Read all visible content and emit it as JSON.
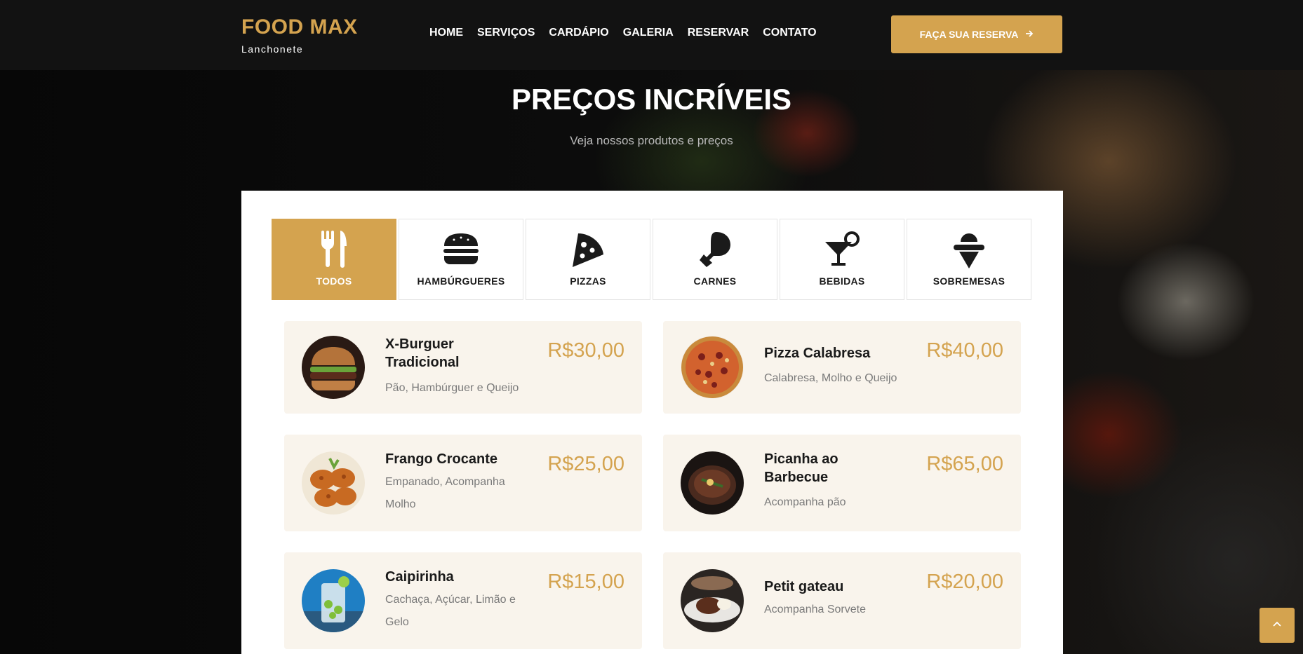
{
  "header": {
    "brand": "FOOD MAX",
    "tagline": "Lanchonete",
    "nav": [
      "HOME",
      "SERVIÇOS",
      "CARDÁPIO",
      "GALERIA",
      "RESERVAR",
      "CONTATO"
    ],
    "cta_label": "FAÇA SUA RESERVA",
    "cta_icon": "arrow-right-icon"
  },
  "hero": {
    "title": "PREÇOS INCRÍVEIS",
    "subtitle": "Veja nossos produtos e preços"
  },
  "tabs": [
    {
      "label": "TODOS",
      "icon": "utensils-icon",
      "active": true
    },
    {
      "label": "HAMBÚRGUERES",
      "icon": "hamburger-icon",
      "active": false
    },
    {
      "label": "PIZZAS",
      "icon": "pizza-slice-icon",
      "active": false
    },
    {
      "label": "CARNES",
      "icon": "drumstick-icon",
      "active": false
    },
    {
      "label": "BEBIDAS",
      "icon": "cocktail-icon",
      "active": false
    },
    {
      "label": "SOBREMESAS",
      "icon": "ice-cream-icon",
      "active": false
    }
  ],
  "menu": [
    {
      "name": "X-Burguer Tradicional",
      "desc": "Pão, Hambúrguer e Queijo",
      "price": "R$30,00",
      "image": "burger-photo"
    },
    {
      "name": "Pizza Calabresa",
      "desc": "Calabresa, Molho e Queijo",
      "price": "R$40,00",
      "image": "pizza-photo"
    },
    {
      "name": "Frango Crocante",
      "desc": "Empanado, Acompanha Molho",
      "price": "R$25,00",
      "image": "fried-chicken-photo"
    },
    {
      "name": "Picanha ao Barbecue",
      "desc": "Acompanha pão",
      "price": "R$65,00",
      "image": "steak-photo"
    },
    {
      "name": "Caipirinha",
      "desc": "Cachaça, Açúcar, Limão e Gelo",
      "price": "R$15,00",
      "image": "caipirinha-photo"
    },
    {
      "name": "Petit gateau",
      "desc": "Acompanha Sorvete",
      "price": "R$20,00",
      "image": "petit-gateau-photo"
    }
  ],
  "colors": {
    "accent": "#d4a34f",
    "card_bg": "#f9f4ec",
    "dark": "#121212"
  },
  "back_to_top_icon": "chevron-up-icon"
}
